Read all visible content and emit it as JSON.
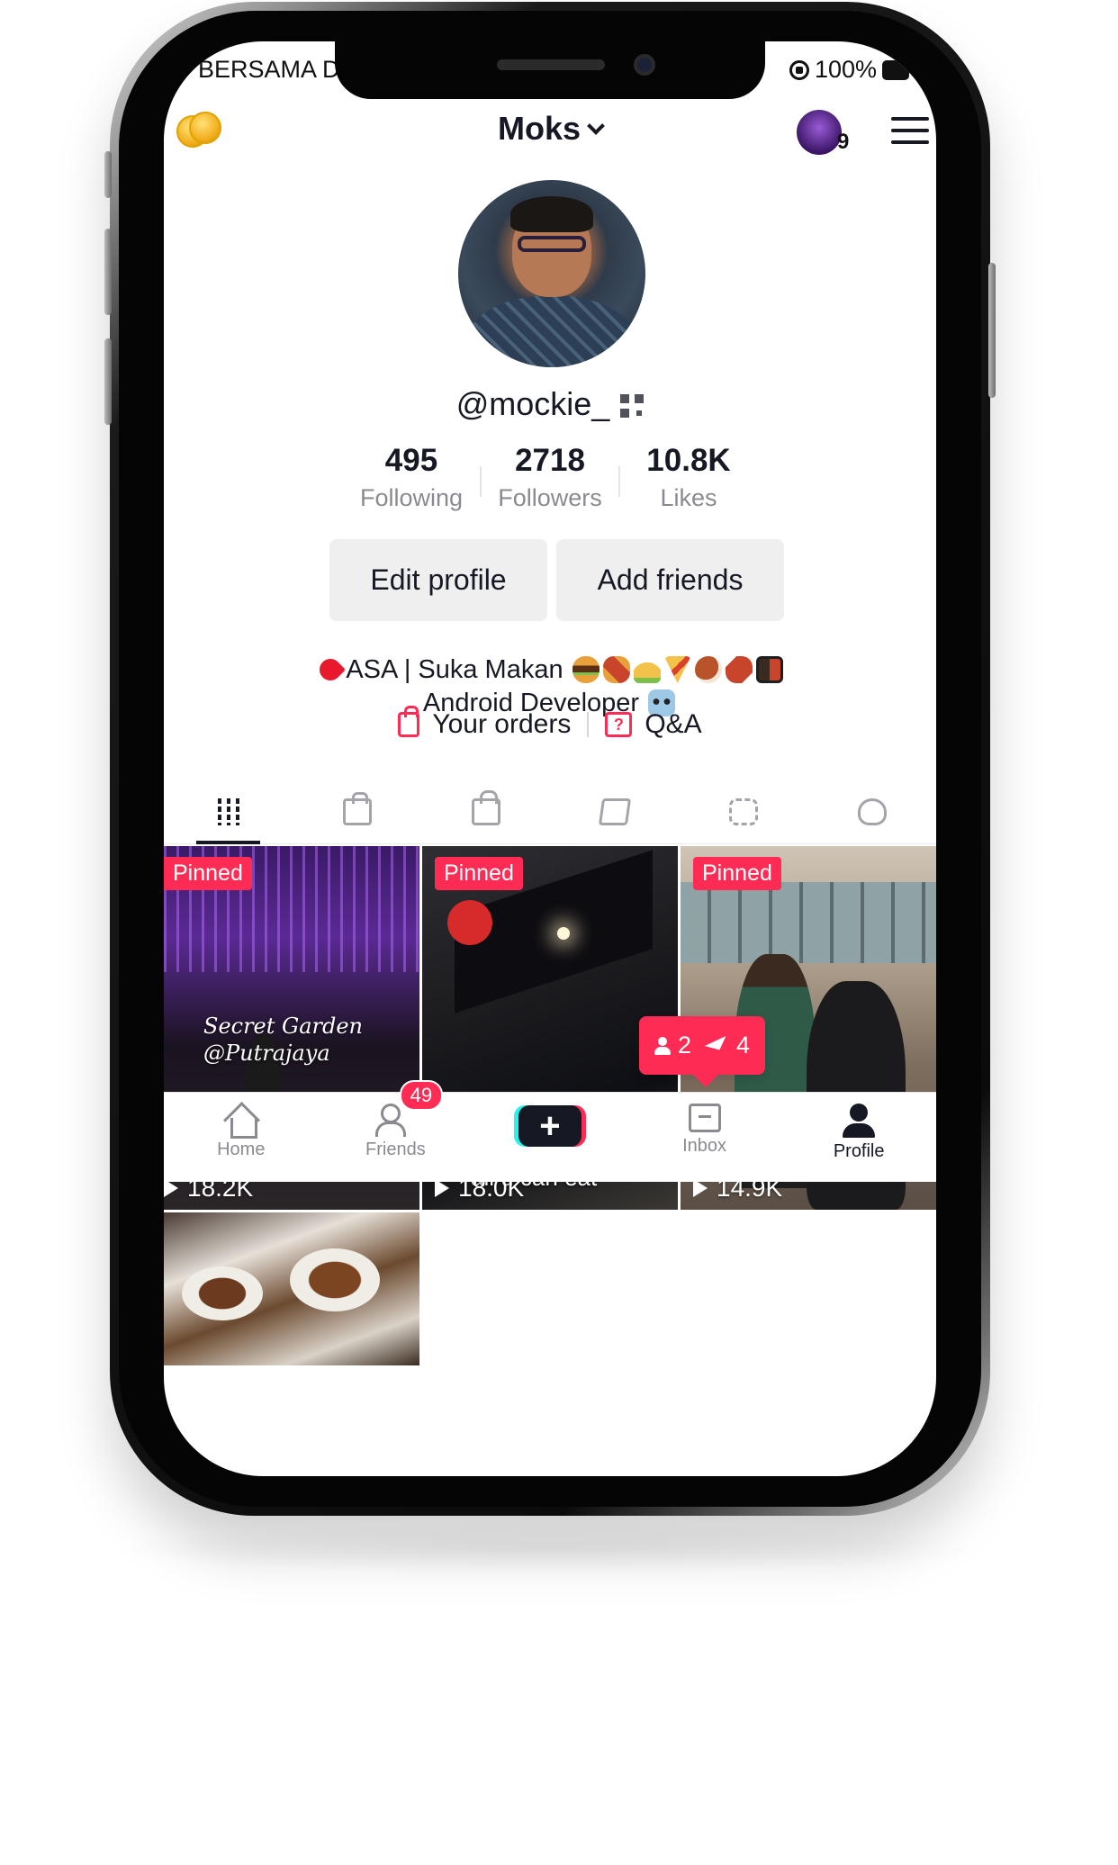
{
  "status_bar": {
    "carrier": "BERSAMA DI",
    "battery": "100%"
  },
  "header": {
    "title": "Moks",
    "inbox_avatar_count": "9",
    "icons": [
      "coins-icon",
      "chevron-down-icon",
      "menu-icon"
    ]
  },
  "profile": {
    "username": "@mockie_",
    "stats": [
      {
        "value": "495",
        "label": "Following"
      },
      {
        "value": "2718",
        "label": "Followers"
      },
      {
        "value": "10.8K",
        "label": "Likes"
      }
    ],
    "edit_button": "Edit profile",
    "add_friends_button": "Add friends",
    "bio_line1": "ASA | Suka Makan",
    "bio_line2": "Android Developer",
    "links": {
      "orders": "Your orders",
      "qa": "Q&A",
      "qa_icon_text": "?"
    }
  },
  "tabs": [
    "videos",
    "shop",
    "private",
    "tagged",
    "reposts",
    "liked"
  ],
  "videos": [
    {
      "pinned": "Pinned",
      "views": "18.2K",
      "caption": "Secret Garden\n@Putrajaya"
    },
    {
      "pinned": "Pinned",
      "views": "18.0K",
      "caption": "all u can eat"
    },
    {
      "pinned": "Pinned",
      "views": "14.9K"
    },
    {}
  ],
  "notification": {
    "followers": "2",
    "messages": "4"
  },
  "bottom_nav": {
    "items": [
      {
        "label": "Home",
        "icon": "home-icon"
      },
      {
        "label": "Friends",
        "icon": "friends-icon",
        "badge": "49"
      },
      {
        "label": "+",
        "icon": "create-icon"
      },
      {
        "label": "Inbox",
        "icon": "inbox-icon"
      },
      {
        "label": "Profile",
        "icon": "profile-icon",
        "active": true
      }
    ]
  },
  "colors": {
    "accent": "#fe2c55",
    "text": "#161823",
    "muted": "#8a8b91",
    "cyan": "#25f4ee"
  }
}
